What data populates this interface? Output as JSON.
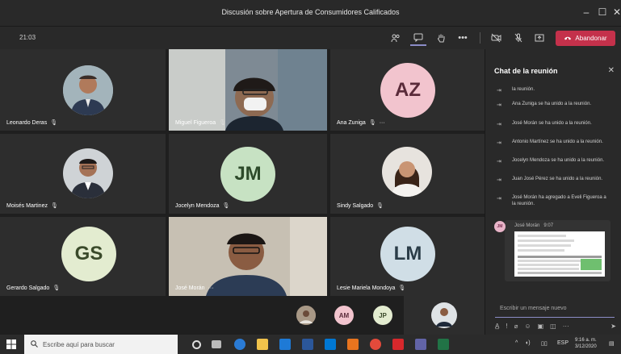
{
  "window": {
    "title": "Discusión sobre Apertura de Consumidores Calificados",
    "minimize": "–",
    "maximize": "☐",
    "close": "✕"
  },
  "toolbar": {
    "timer": "21:03",
    "leave_label": "Abandonar",
    "icons": [
      "people-icon",
      "chat-icon",
      "raise-hand-icon",
      "more-icon",
      "camera-off-icon",
      "mic-off-icon",
      "share-icon"
    ]
  },
  "participants": [
    {
      "name": "Leonardo Deras",
      "initials": ""
    },
    {
      "name": "Miguel Figueroa",
      "initials": ""
    },
    {
      "name": "Ana Zuniga",
      "initials": "AZ",
      "color": "#f2c4ce",
      "text_color": "#5a2b3a"
    },
    {
      "name": "Moisés Martinez",
      "initials": ""
    },
    {
      "name": "Jocelyn Mendoza",
      "initials": "JM",
      "color": "#c7e2c3",
      "text_color": "#2d4a2a"
    },
    {
      "name": "Sindy Salgado",
      "initials": ""
    },
    {
      "name": "Gerardo Salgado",
      "initials": "GS",
      "color": "#e3ecd0",
      "text_color": "#3a4a2a"
    },
    {
      "name": "José Morán",
      "initials": ""
    },
    {
      "name": "Lesie Mariela Mondoya",
      "initials": "LM",
      "color": "#d0dee6",
      "text_color": "#2b3d48"
    }
  ],
  "strip": {
    "avatars": [
      {
        "initials": "",
        "color": "#8a7a6a"
      },
      {
        "initials": "AM",
        "color": "#f2c4ce"
      },
      {
        "initials": "JP",
        "color": "#e3ecd0"
      }
    ]
  },
  "chat": {
    "title": "Chat de la reunión",
    "messages": [
      "la reunión.",
      "Ana Zuniga se ha unido a la reunión.",
      "José Morán se ha unido a la reunión.",
      "Antonio Martínez se ha unido a la reunión.",
      "Jocelyn Mendoza se ha unido a la reunión.",
      "Juan José Pérez se ha unido a la reunión.",
      "José Morán ha agregado a Eveli Figueroa a la reunión."
    ],
    "bubble_sender": "José Morán",
    "bubble_time": "9:07",
    "bubble_initials": "JM",
    "input_placeholder": "Escribir un mensaje nuevo"
  },
  "taskbar": {
    "search_placeholder": "Escribe aquí para buscar",
    "lang": "ESP",
    "time": "9:16 a. m.",
    "date": "3/12/2020"
  }
}
